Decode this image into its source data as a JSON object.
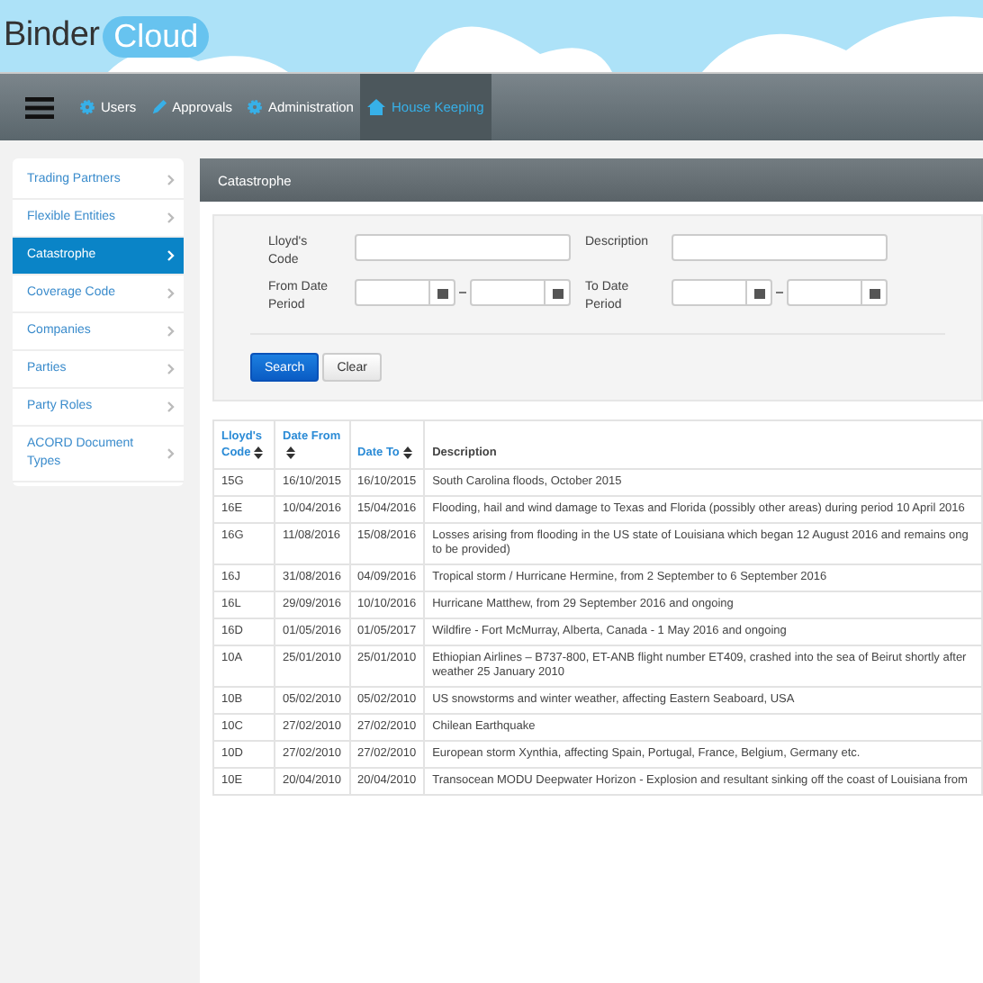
{
  "logo": {
    "word": "Binder",
    "badge": "Cloud"
  },
  "nav": {
    "items": [
      {
        "label": "Users",
        "selected": false
      },
      {
        "label": "Approvals",
        "selected": false
      },
      {
        "label": "Administration",
        "selected": false
      },
      {
        "label": "House Keeping",
        "selected": true
      }
    ]
  },
  "sidebar": {
    "items": [
      {
        "label": "Trading Partners",
        "selected": false
      },
      {
        "label": "Flexible Entities",
        "selected": false
      },
      {
        "label": "Catastrophe",
        "selected": true
      },
      {
        "label": "Coverage Code",
        "selected": false
      },
      {
        "label": "Companies",
        "selected": false
      },
      {
        "label": "Parties",
        "selected": false
      },
      {
        "label": "Party Roles",
        "selected": false
      },
      {
        "label": "ACORD Document Types",
        "selected": false
      }
    ]
  },
  "panel": {
    "title": "Catastrophe"
  },
  "search_form": {
    "lloyds_code_label": "Lloyd's Code",
    "description_label": "Description",
    "from_date_label": "From Date Period",
    "to_date_label": "To Date Period",
    "buttons": [
      {
        "label": "Search",
        "kind": "primary"
      },
      {
        "label": "Clear",
        "kind": "default"
      }
    ]
  },
  "table": {
    "columns": [
      {
        "label": "Lloyd's Code",
        "sortable": true
      },
      {
        "label": "Date From",
        "sortable": true
      },
      {
        "label": "Date To",
        "sortable": true
      },
      {
        "label": "Description",
        "sortable": false
      }
    ],
    "rows": [
      [
        "15G",
        "16/10/2015",
        "16/10/2015",
        "South Carolina floods, October 2015"
      ],
      [
        "16E",
        "10/04/2016",
        "15/04/2016",
        "Flooding, hail and wind damage to Texas and Florida (possibly other areas) during period 10 April 2016"
      ],
      [
        "16G",
        "11/08/2016",
        "15/08/2016",
        "Losses arising from flooding in the US state of Louisiana which began 12 August 2016 and remains ong to be provided)"
      ],
      [
        "16J",
        "31/08/2016",
        "04/09/2016",
        "Tropical storm / Hurricane Hermine, from 2 September to 6 September 2016"
      ],
      [
        "16L",
        "29/09/2016",
        "10/10/2016",
        "Hurricane Matthew, from 29 September 2016 and ongoing"
      ],
      [
        "16D",
        "01/05/2016",
        "01/05/2017",
        "Wildfire - Fort McMurray, Alberta, Canada - 1 May 2016 and ongoing"
      ],
      [
        "10A",
        "25/01/2010",
        "25/01/2010",
        "Ethiopian Airlines – B737-800, ET-ANB flight number ET409, crashed into the sea of Beirut shortly after weather 25 January 2010"
      ],
      [
        "10B",
        "05/02/2010",
        "05/02/2010",
        "US snowstorms and winter weather, affecting Eastern Seaboard, USA"
      ],
      [
        "10C",
        "27/02/2010",
        "27/02/2010",
        "Chilean Earthquake"
      ],
      [
        "10D",
        "27/02/2010",
        "27/02/2010",
        "European storm Xynthia, affecting Spain, Portugal, France, Belgium, Germany etc."
      ],
      [
        "10E",
        "20/04/2010",
        "20/04/2010",
        "Transocean MODU Deepwater Horizon - Explosion and resultant sinking off the coast of Louisiana from"
      ]
    ]
  }
}
